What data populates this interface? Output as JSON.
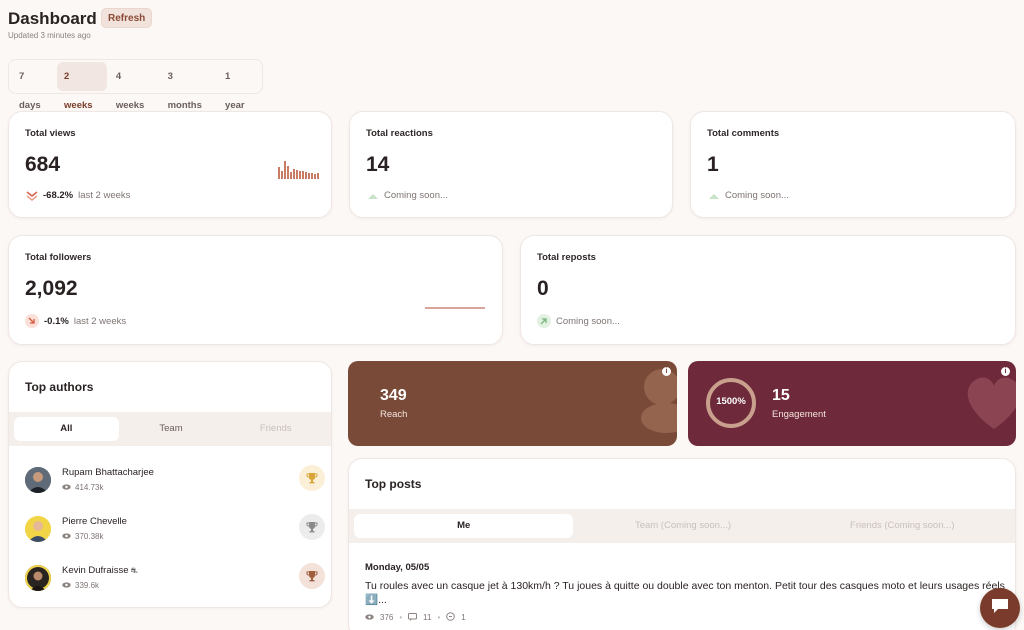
{
  "header": {
    "title": "Dashboard",
    "refresh_label": "Refresh",
    "updated": "Updated 3 minutes ago"
  },
  "periods": [
    "7 days",
    "2 weeks",
    "4 weeks",
    "3 months",
    "1 year"
  ],
  "active_period": "2 weeks",
  "stats": {
    "views": {
      "label": "Total views",
      "value": "684",
      "change": "-68.2%",
      "period": "last 2 weeks"
    },
    "reactions": {
      "label": "Total reactions",
      "value": "14",
      "note": "Coming soon..."
    },
    "comments": {
      "label": "Total comments",
      "value": "1",
      "note": "Coming soon..."
    },
    "followers": {
      "label": "Total followers",
      "value": "2,092",
      "change": "-0.1%",
      "period": "last 2 weeks"
    },
    "reposts": {
      "label": "Total reposts",
      "value": "0",
      "note": "Coming soon..."
    }
  },
  "top_authors": {
    "title": "Top authors",
    "tabs": [
      "All",
      "Team",
      "Friends"
    ],
    "authors": [
      {
        "name": "Rupam Bhattacharjee",
        "views": "414.73k",
        "trophy_color": "#d9a437"
      },
      {
        "name": "Pierre Chevelle",
        "views": "370.38k",
        "trophy_color": "#8a8a8a"
      },
      {
        "name": "Kevin Dufraisse",
        "views": "339.6k",
        "trophy_color": "#a0603e"
      }
    ]
  },
  "reach": {
    "value": "349",
    "label": "Reach",
    "color": "#7a4a38"
  },
  "engagement": {
    "value": "15",
    "label": "Engagement",
    "ring": "1500%",
    "color": "#6e2a3a"
  },
  "top_posts": {
    "title": "Top posts",
    "tabs": [
      "Me",
      "Team (Coming soon...)",
      "Friends (Coming soon...)"
    ],
    "post": {
      "date": "Monday, 05/05",
      "text": "Tu roules avec un casque jet à 130km/h ? Tu joues à quitte ou double avec ton menton. Petit tour des casques moto et leurs usages réels ⬇️...",
      "views": "376",
      "comments": "11",
      "reposts": "1"
    }
  }
}
